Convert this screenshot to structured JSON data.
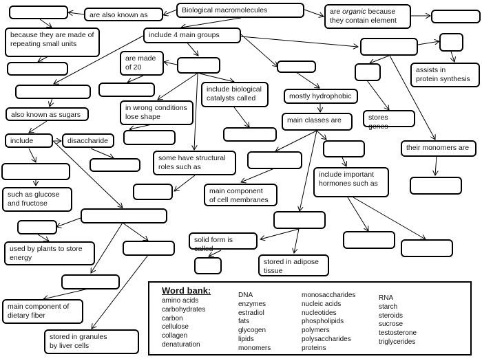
{
  "diagram": {
    "type": "concept-map",
    "nodes": [
      {
        "id": "bio",
        "text": "Biological macromolecules"
      },
      {
        "id": "aka",
        "text": "are also known as"
      },
      {
        "id": "b1",
        "text": ""
      },
      {
        "id": "because",
        "text": "because they are made of\nrepeating small units"
      },
      {
        "id": "b2",
        "text": ""
      },
      {
        "id": "organic",
        "text": "are organic because\nthey contain element"
      },
      {
        "id": "b3",
        "text": ""
      },
      {
        "id": "groups",
        "text": "include 4 main groups"
      },
      {
        "id": "b_carb",
        "text": ""
      },
      {
        "id": "sugars",
        "text": "also known as sugars"
      },
      {
        "id": "include",
        "text": "include"
      },
      {
        "id": "disacch",
        "text": "disaccharide"
      },
      {
        "id": "b_disacch",
        "text": ""
      },
      {
        "id": "b_mono",
        "text": ""
      },
      {
        "id": "glucose",
        "text": "such as  glucose\nand fructose"
      },
      {
        "id": "b_poly",
        "text": ""
      },
      {
        "id": "b_starch",
        "text": ""
      },
      {
        "id": "plants",
        "text": "used by plants to store\nenergy"
      },
      {
        "id": "b_glyco",
        "text": ""
      },
      {
        "id": "b_cell",
        "text": ""
      },
      {
        "id": "fiber",
        "text": "main component of\ndietary fiber"
      },
      {
        "id": "granules",
        "text": "stored in granules\nby liver cells"
      },
      {
        "id": "b_prot",
        "text": ""
      },
      {
        "id": "made20",
        "text": "are made\nof 20"
      },
      {
        "id": "b_amino",
        "text": ""
      },
      {
        "id": "wrong",
        "text": "in wrong conditions\nlose shape"
      },
      {
        "id": "b_denat",
        "text": ""
      },
      {
        "id": "catalysts",
        "text": "include biological\ncatalysts called"
      },
      {
        "id": "b_enz",
        "text": ""
      },
      {
        "id": "structural",
        "text": "some have structural\nroles such as"
      },
      {
        "id": "b_coll",
        "text": ""
      },
      {
        "id": "b_lip",
        "text": ""
      },
      {
        "id": "hydro",
        "text": "mostly hydrophobic"
      },
      {
        "id": "classes",
        "text": "main classes are"
      },
      {
        "id": "b_phos",
        "text": ""
      },
      {
        "id": "membranes",
        "text": "main component\nof cell membranes"
      },
      {
        "id": "b_ster",
        "text": ""
      },
      {
        "id": "hormones",
        "text": "include important\nhormones such as"
      },
      {
        "id": "b_est",
        "text": ""
      },
      {
        "id": "b_test",
        "text": ""
      },
      {
        "id": "b_trig",
        "text": ""
      },
      {
        "id": "solid",
        "text": "solid form is called"
      },
      {
        "id": "b_fats",
        "text": ""
      },
      {
        "id": "adipose",
        "text": "stored in adipose\ntissue"
      },
      {
        "id": "b_na",
        "text": ""
      },
      {
        "id": "b_rna",
        "text": ""
      },
      {
        "id": "assists",
        "text": "assists in\nprotein synthesis"
      },
      {
        "id": "b_dna",
        "text": ""
      },
      {
        "id": "genes",
        "text": "stores genes"
      },
      {
        "id": "monomers",
        "text": "their monomers are"
      },
      {
        "id": "b_nucl",
        "text": ""
      }
    ]
  },
  "word_bank": {
    "title": "Word bank:",
    "columns": [
      [
        "amino acids",
        "carbohydrates",
        "carbon",
        "cellulose",
        "collagen",
        "denaturation"
      ],
      [
        "DNA",
        "enzymes",
        "estradiol",
        "fats",
        "glycogen",
        "lipids",
        "monomers"
      ],
      [
        "monosaccharides",
        "nucleic acids",
        "nucleotides",
        "phospholipids",
        "polymers",
        "polysaccharides",
        "proteins"
      ],
      [
        "RNA",
        "starch",
        "steroids",
        "sucrose",
        "testosterone",
        "triglycerides"
      ]
    ]
  }
}
